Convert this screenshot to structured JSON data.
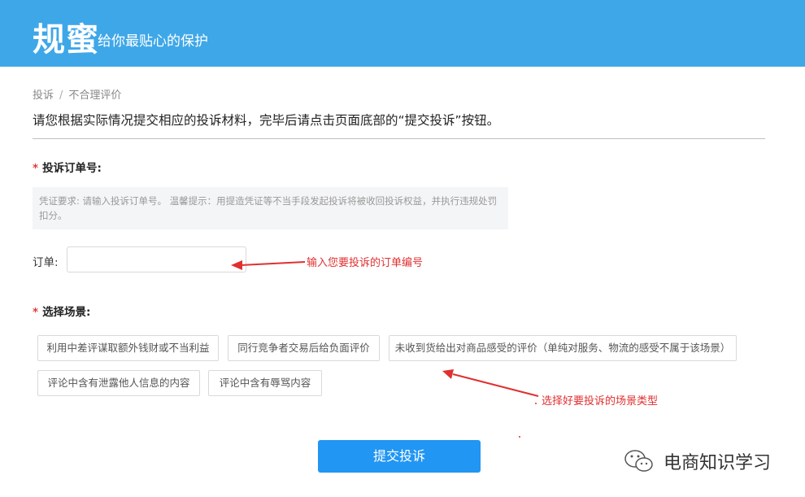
{
  "header": {
    "logo": "规蜜",
    "slogan": "给你最贴心的保护"
  },
  "breadcrumb": {
    "items": [
      "投诉",
      "不合理评价"
    ],
    "separator": "/"
  },
  "intro": "请您根据实际情况提交相应的投诉材料，完毕后请点击页面底部的“提交投诉”按钮。",
  "order_section": {
    "required_mark": "*",
    "title": "投诉订单号:",
    "hint": "凭证要求: 请输入投诉订单号。 温馨提示：用提造凭证等不当手段发起投诉将被收回投诉权益，并执行违规处罚扣分。",
    "field_label": "订单:",
    "field_value": "",
    "annotation": "输入您要投诉的订单编号"
  },
  "scene_section": {
    "required_mark": "*",
    "title": "选择场景:",
    "options": [
      "利用中差评谋取额外钱财或不当利益",
      "同行竞争者交易后给负面评价",
      "未收到货给出对商品感受的评价（单纯对服务、物流的感受不属于该场景）",
      "评论中含有泄露他人信息的内容",
      "评论中含有辱骂内容"
    ],
    "annotation": "选择好要投诉的场景类型"
  },
  "submit_label": "提交投诉",
  "watermark": {
    "icon": "wechat-icon",
    "text": "电商知识学习"
  },
  "colors": {
    "header": "#3ea7e8",
    "submit": "#2196f3",
    "annotation": "#e03030",
    "required": "#e23b3b"
  }
}
